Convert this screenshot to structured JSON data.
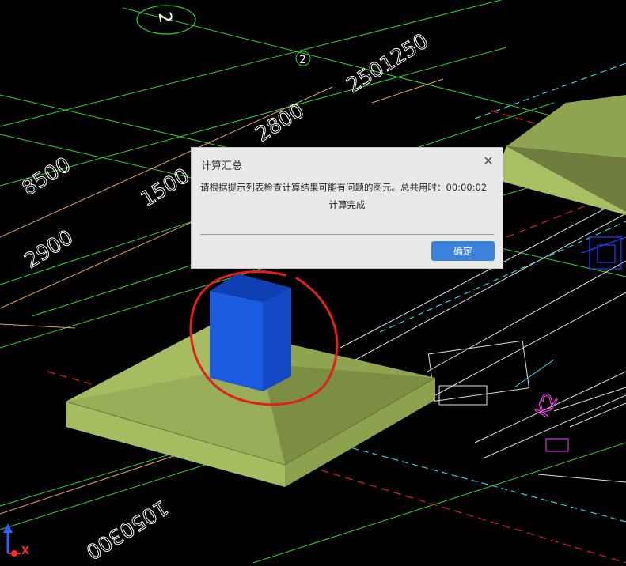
{
  "scene": {
    "grid_bubble": "2",
    "grid_axis_label": "2",
    "dimensions": {
      "d1": "2501250",
      "d2": "2800",
      "d3": "8500",
      "d4": "1500",
      "d5": "2900",
      "d6": "1050300"
    },
    "magenta_label": "K2"
  },
  "dialog": {
    "title": "计算汇总",
    "message": "请根据提示列表检查计算结果可能有问题的图元。总共用时：00:00:02",
    "status": "计算完成",
    "ok_label": "确定",
    "close_symbol": "✕"
  },
  "axis": {
    "x_label": "X"
  },
  "colors": {
    "background": "#000000",
    "footing": "#9fb760",
    "column": "#1a5be0",
    "annotation_circle": "#e0201c",
    "button": "#3b82db"
  }
}
